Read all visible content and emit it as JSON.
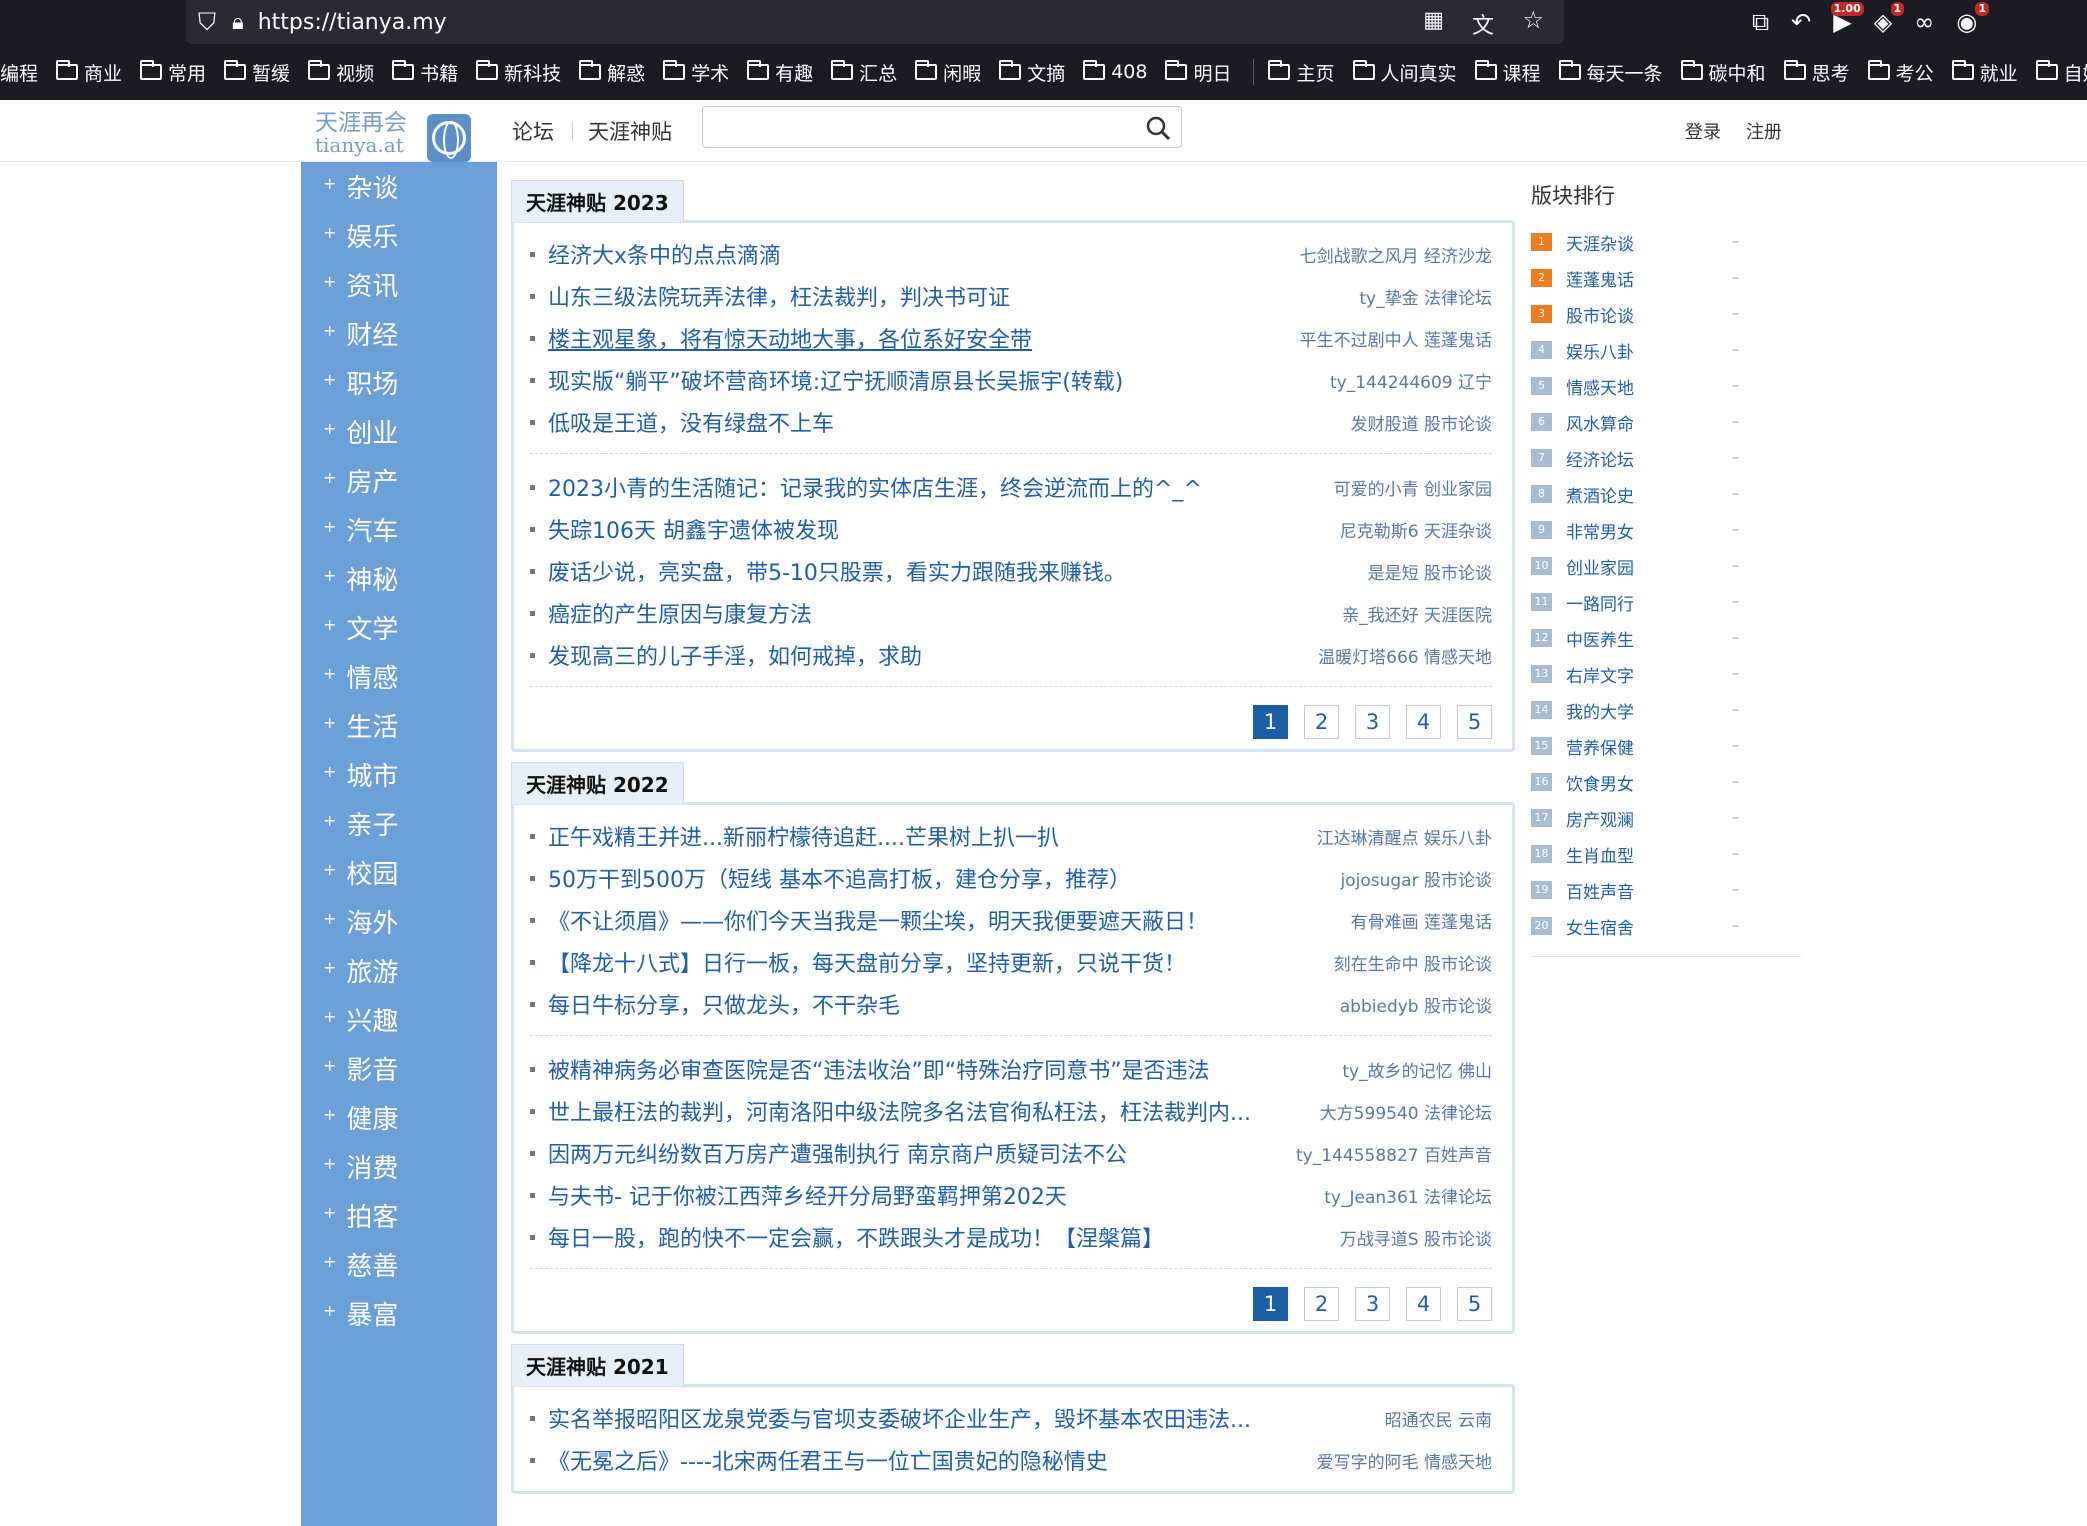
{
  "browser": {
    "url": "https://tianya.my",
    "badge_speed": "1.00",
    "badge_one": "1",
    "badge_red": "1"
  },
  "bookmarks": [
    {
      "label": "编程",
      "folder": false
    },
    {
      "label": "商业",
      "folder": true
    },
    {
      "label": "常用",
      "folder": true
    },
    {
      "label": "暂缓",
      "folder": true
    },
    {
      "label": "视频",
      "folder": true
    },
    {
      "label": "书籍",
      "folder": true
    },
    {
      "label": "新科技",
      "folder": true
    },
    {
      "label": "解惑",
      "folder": true
    },
    {
      "label": "学术",
      "folder": true
    },
    {
      "label": "有趣",
      "folder": true
    },
    {
      "label": "汇总",
      "folder": true
    },
    {
      "label": "闲暇",
      "folder": true
    },
    {
      "label": "文摘",
      "folder": true
    },
    {
      "label": "408",
      "folder": true
    },
    {
      "label": "明日",
      "folder": true
    },
    {
      "label": "|",
      "folder": false
    },
    {
      "label": "主页",
      "folder": true
    },
    {
      "label": "人间真实",
      "folder": true
    },
    {
      "label": "课程",
      "folder": true
    },
    {
      "label": "每天一条",
      "folder": true
    },
    {
      "label": "碳中和",
      "folder": true
    },
    {
      "label": "思考",
      "folder": true
    },
    {
      "label": "考公",
      "folder": true
    },
    {
      "label": "就业",
      "folder": true
    },
    {
      "label": "自媒",
      "folder": true
    }
  ],
  "header": {
    "logo_cn": "天涯再会",
    "logo_en": "tianya.at",
    "nav_forum": "论坛",
    "nav_god": "天涯神贴",
    "search_placeholder": "",
    "login": "登录",
    "register": "注册"
  },
  "sidebar": [
    "杂谈",
    "娱乐",
    "资讯",
    "财经",
    "职场",
    "创业",
    "房产",
    "汽车",
    "神秘",
    "文学",
    "情感",
    "生活",
    "城市",
    "亲子",
    "校园",
    "海外",
    "旅游",
    "兴趣",
    "影音",
    "健康",
    "消费",
    "拍客",
    "慈善",
    "暴富"
  ],
  "sections": [
    {
      "title": "天涯神贴 2023",
      "groups": [
        [
          {
            "title": "经济大x条中的点点滴滴",
            "meta": "七剑战歌之风月 经济沙龙",
            "ul": false
          },
          {
            "title": "山东三级法院玩弄法律，枉法裁判，判决书可证",
            "meta": "ty_挚金 法律论坛",
            "ul": false
          },
          {
            "title": "楼主观星象，将有惊天动地大事，各位系好安全带",
            "meta": "平生不过剧中人 莲蓬鬼话",
            "ul": true
          },
          {
            "title": "现实版“躺平”破坏营商环境:辽宁抚顺清原县长吴振宇(转载)",
            "meta": "ty_144244609 辽宁",
            "ul": false
          },
          {
            "title": "低吸是王道，没有绿盘不上车",
            "meta": "发财股道 股市论谈",
            "ul": false
          }
        ],
        [
          {
            "title": "2023小青的生活随记：记录我的实体店生涯，终会逆流而上的^_^",
            "meta": "可爱的小青 创业家园",
            "ul": false
          },
          {
            "title": "失踪106天 胡鑫宇遗体被发现",
            "meta": "尼克勒斯6 天涯杂谈",
            "ul": false
          },
          {
            "title": "废话少说，亮实盘，带5-10只股票，看实力跟随我来赚钱。",
            "meta": "是是短 股市论谈",
            "ul": false
          },
          {
            "title": "癌症的产生原因与康复方法",
            "meta": "亲_我还好 天涯医院",
            "ul": false
          },
          {
            "title": "发现高三的儿子手淫，如何戒掉，求助",
            "meta": "温暖灯塔666 情感天地",
            "ul": false
          }
        ]
      ],
      "pages": [
        "1",
        "2",
        "3",
        "4",
        "5"
      ]
    },
    {
      "title": "天涯神贴 2022",
      "groups": [
        [
          {
            "title": "正午戏精王并进...新丽柠檬待追赶....芒果树上扒一扒",
            "meta": "江达琳清醒点 娱乐八卦",
            "ul": false
          },
          {
            "title": "50万干到500万（短线 基本不追高打板，建仓分享，推荐）",
            "meta": "jojosugar 股市论谈",
            "ul": false
          },
          {
            "title": "《不让须眉》——你们今天当我是一颗尘埃，明天我便要遮天蔽日！",
            "meta": "有骨难画 莲蓬鬼话",
            "ul": false
          },
          {
            "title": "【降龙十八式】日行一板，每天盘前分享，坚持更新，只说干货！",
            "meta": "刻在生命中 股市论谈",
            "ul": false
          },
          {
            "title": "每日牛标分享，只做龙头，不干杂毛",
            "meta": "abbiedyb 股市论谈",
            "ul": false
          }
        ],
        [
          {
            "title": "被精神病务必审查医院是否“违法收治”即“特殊治疗同意书”是否违法",
            "meta": "ty_故乡的记忆 佛山",
            "ul": false
          },
          {
            "title": "世上最枉法的裁判，河南洛阳中级法院多名法官徇私枉法，枉法裁判内...",
            "meta": "大方599540 法律论坛",
            "ul": false
          },
          {
            "title": "因两万元纠纷数百万房产遭强制执行 南京商户质疑司法不公",
            "meta": "ty_144558827 百姓声音",
            "ul": false
          },
          {
            "title": "与夫书- 记于你被江西萍乡经开分局野蛮羁押第202天",
            "meta": "ty_Jean361 法律论坛",
            "ul": false
          },
          {
            "title": "每日一股，跑的快不一定会赢，不跌跟头才是成功！【涅槃篇】",
            "meta": "万战寻道S 股市论谈",
            "ul": false
          }
        ]
      ],
      "pages": [
        "1",
        "2",
        "3",
        "4",
        "5"
      ]
    },
    {
      "title": "天涯神贴 2021",
      "groups": [
        [
          {
            "title": "实名举报昭阳区龙泉党委与官坝支委破坏企业生产，毁坏基本农田违法...",
            "meta": "昭通农民 云南",
            "ul": false
          },
          {
            "title": "《无冕之后》----北宋两任君王与一位亡国贵妃的隐秘情史",
            "meta": "爱写字的阿毛 情感天地",
            "ul": false
          }
        ]
      ],
      "pages": []
    }
  ],
  "rank": {
    "title": "版块排行",
    "items": [
      {
        "num": "1",
        "name": "天涯杂谈",
        "dash": "–"
      },
      {
        "num": "2",
        "name": "莲蓬鬼话",
        "dash": "–"
      },
      {
        "num": "3",
        "name": "股市论谈",
        "dash": "–"
      },
      {
        "num": "4",
        "name": "娱乐八卦",
        "dash": "–"
      },
      {
        "num": "5",
        "name": "情感天地",
        "dash": "–"
      },
      {
        "num": "6",
        "name": "风水算命",
        "dash": "–"
      },
      {
        "num": "7",
        "name": "经济论坛",
        "dash": "–"
      },
      {
        "num": "8",
        "name": "煮酒论史",
        "dash": "–"
      },
      {
        "num": "9",
        "name": "非常男女",
        "dash": "–"
      },
      {
        "num": "10",
        "name": "创业家园",
        "dash": "–"
      },
      {
        "num": "11",
        "name": "一路同行",
        "dash": "–"
      },
      {
        "num": "12",
        "name": "中医养生",
        "dash": "–"
      },
      {
        "num": "13",
        "name": "右岸文字",
        "dash": "–"
      },
      {
        "num": "14",
        "name": "我的大学",
        "dash": "–"
      },
      {
        "num": "15",
        "name": "营养保健",
        "dash": "–"
      },
      {
        "num": "16",
        "name": "饮食男女",
        "dash": "–"
      },
      {
        "num": "17",
        "name": "房产观澜",
        "dash": "–"
      },
      {
        "num": "18",
        "name": "生肖血型",
        "dash": "–"
      },
      {
        "num": "19",
        "name": "百姓声音",
        "dash": "–"
      },
      {
        "num": "20",
        "name": "女生宿舍",
        "dash": "–"
      }
    ]
  },
  "colors": {
    "sidebar_bg": "#6a9fd7",
    "link": "#1f5fa8",
    "meta": "#5877a6",
    "rank_top": "#f17c1b",
    "rank_other": "#a7bcd2",
    "page_active": "#1a5da8"
  }
}
